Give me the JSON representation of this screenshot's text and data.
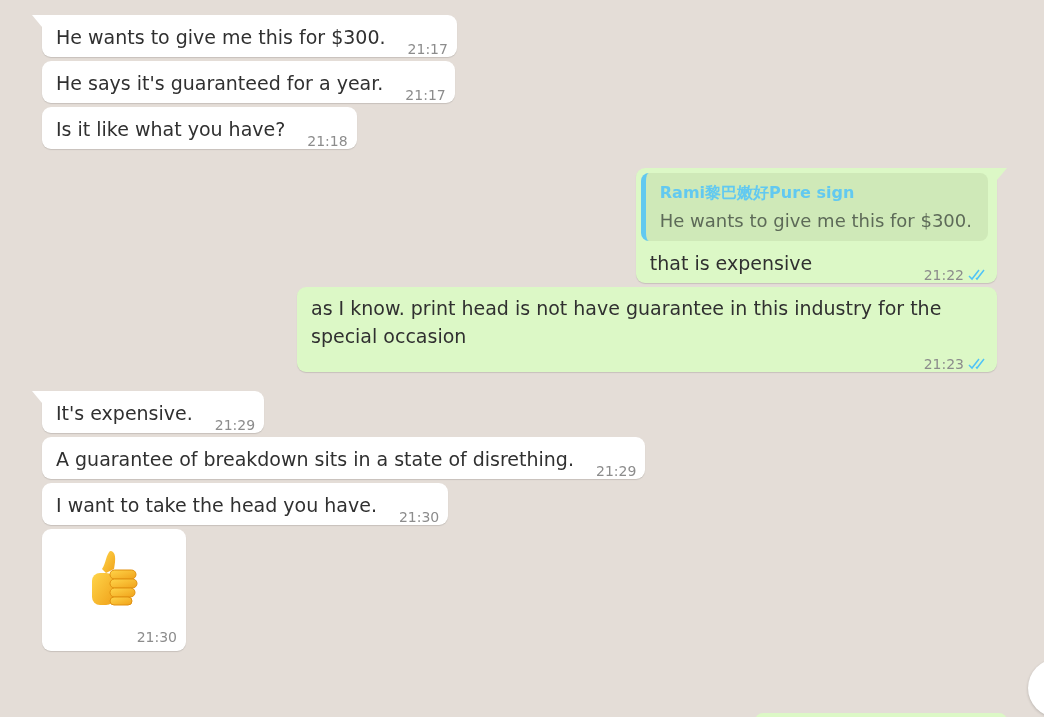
{
  "messages": [
    {
      "kind": "text",
      "outgoing": false,
      "tail": true,
      "text": "He wants to give me this for $300.",
      "time": "21:17"
    },
    {
      "kind": "text",
      "outgoing": false,
      "tail": false,
      "text": "He says it's guaranteed for a year.",
      "time": "21:17"
    },
    {
      "kind": "text",
      "outgoing": false,
      "tail": false,
      "text": "Is it like what you have?",
      "time": "21:18"
    },
    {
      "kind": "text",
      "outgoing": true,
      "tail": true,
      "quote": {
        "author": "Rami黎巴嫩好Pure sign",
        "text": "He wants to give me this for $300."
      },
      "text": "that is expensive",
      "time": "21:22",
      "read": true
    },
    {
      "kind": "text",
      "outgoing": true,
      "tail": false,
      "text": "as I know. print head is not have guarantee in this industry for the special occasion",
      "time": "21:23",
      "read": true
    },
    {
      "kind": "text",
      "outgoing": false,
      "tail": true,
      "text": "It's expensive.",
      "time": "21:29"
    },
    {
      "kind": "text",
      "outgoing": false,
      "tail": false,
      "text": "A guarantee of breakdown sits in a state of disrething.",
      "time": "21:29"
    },
    {
      "kind": "text",
      "outgoing": false,
      "tail": false,
      "text": "I want to take the head you have.",
      "time": "21:30"
    },
    {
      "kind": "sticker",
      "outgoing": false,
      "tail": false,
      "time": "21:30"
    }
  ]
}
